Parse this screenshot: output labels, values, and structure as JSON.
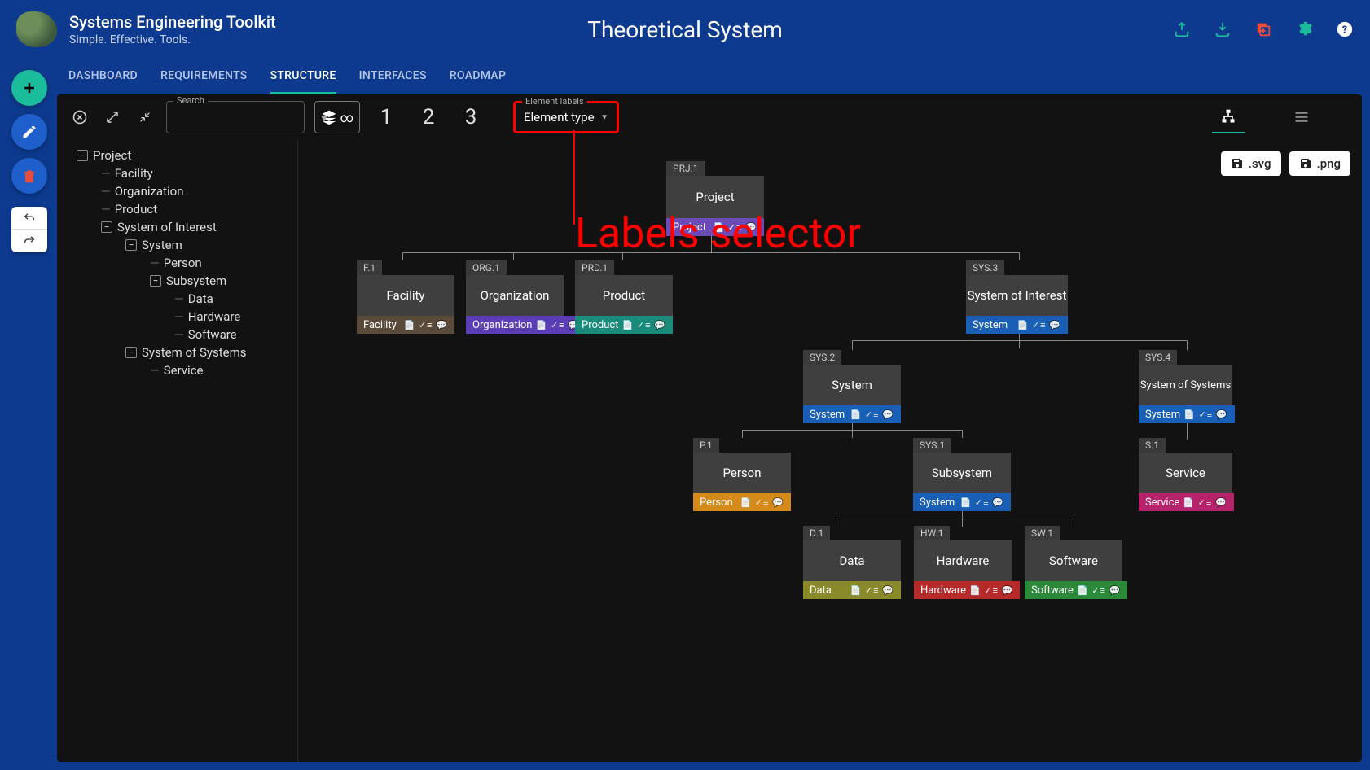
{
  "app": {
    "title": "Systems Engineering Toolkit",
    "tagline": "Simple. Effective. Tools."
  },
  "page_title": "Theoretical System",
  "tabs": [
    "DASHBOARD",
    "REQUIREMENTS",
    "STRUCTURE",
    "INTERFACES",
    "ROADMAP"
  ],
  "active_tab": "STRUCTURE",
  "toolbar": {
    "search_label": "Search",
    "depth_options": [
      "1",
      "2",
      "3"
    ],
    "labels_label": "Element labels",
    "labels_value": "Element type"
  },
  "export": {
    "svg": ".svg",
    "png": ".png"
  },
  "annotation": "Labels selector",
  "tree": {
    "root": "Project",
    "children": [
      {
        "label": "Facility"
      },
      {
        "label": "Organization"
      },
      {
        "label": "Product"
      },
      {
        "label": "System of Interest",
        "expanded": true,
        "children": [
          {
            "label": "System",
            "expanded": true,
            "children": [
              {
                "label": "Person"
              },
              {
                "label": "Subsystem",
                "expanded": true,
                "children": [
                  {
                    "label": "Data"
                  },
                  {
                    "label": "Hardware"
                  },
                  {
                    "label": "Software"
                  }
                ]
              }
            ]
          }
        ]
      },
      {
        "label": "System of Systems",
        "expanded": true,
        "children": [
          {
            "label": "Service"
          }
        ]
      }
    ]
  },
  "nodes": {
    "prj": {
      "tag": "PRJ.1",
      "title": "Project",
      "type": "Project",
      "color": "#6d4bb6"
    },
    "fac": {
      "tag": "F.1",
      "title": "Facility",
      "type": "Facility",
      "color": "#5a4a3a"
    },
    "org": {
      "tag": "ORG.1",
      "title": "Organization",
      "type": "Organization",
      "color": "#5b3db6"
    },
    "prd": {
      "tag": "PRD.1",
      "title": "Product",
      "type": "Product",
      "color": "#1a8a7a"
    },
    "sys3": {
      "tag": "SYS.3",
      "title": "System of Interest",
      "type": "System",
      "color": "#1a5fb6"
    },
    "sys2": {
      "tag": "SYS.2",
      "title": "System",
      "type": "System",
      "color": "#1a5fb6"
    },
    "sys4": {
      "tag": "SYS.4",
      "title": "System of Systems",
      "type": "System",
      "color": "#1a5fb6"
    },
    "p1": {
      "tag": "P.1",
      "title": "Person",
      "type": "Person",
      "color": "#d68a1a"
    },
    "sys1": {
      "tag": "SYS.1",
      "title": "Subsystem",
      "type": "System",
      "color": "#1a5fb6"
    },
    "s1": {
      "tag": "S.1",
      "title": "Service",
      "type": "Service",
      "color": "#b6236a"
    },
    "d1": {
      "tag": "D.1",
      "title": "Data",
      "type": "Data",
      "color": "#8a8a2a"
    },
    "hw1": {
      "tag": "HW.1",
      "title": "Hardware",
      "type": "Hardware",
      "color": "#b62a2a"
    },
    "sw1": {
      "tag": "SW.1",
      "title": "Software",
      "type": "Software",
      "color": "#2a8a3a"
    }
  }
}
